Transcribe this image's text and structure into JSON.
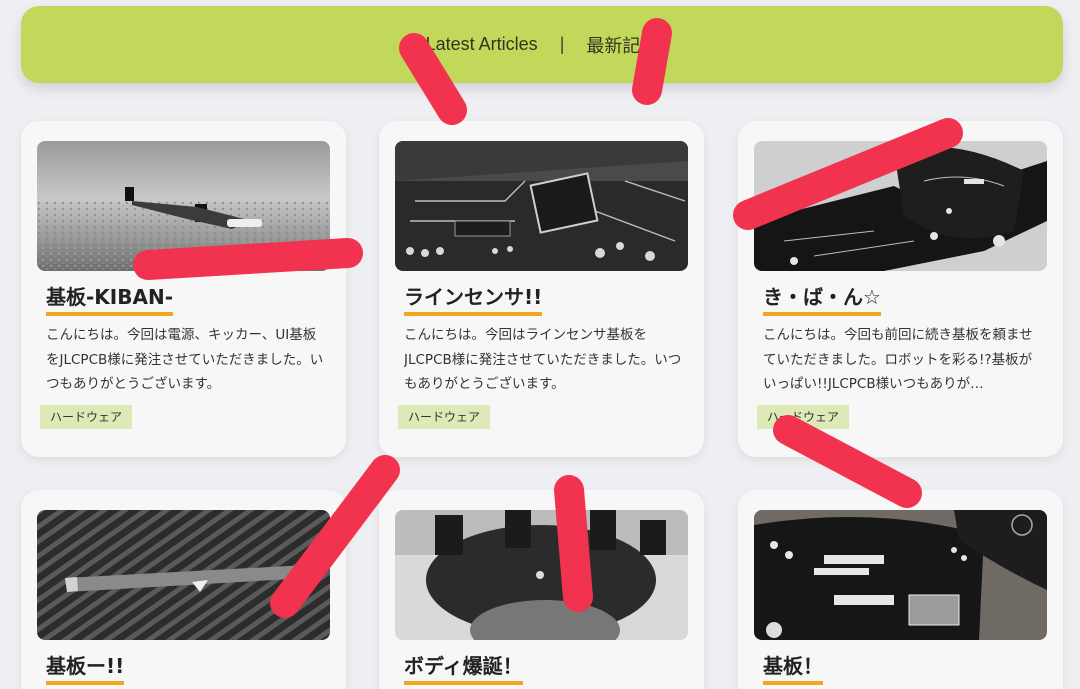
{
  "header": {
    "latest_articles": "Latest Articles",
    "separator": "|",
    "japanese_label": "最新記事"
  },
  "colors": {
    "header_bg": "#c2d85a",
    "title_underline": "#f0a61e",
    "tag_bg": "#dde9b7",
    "scribble": "#f2334f"
  },
  "cards": [
    {
      "title": "基板-KIBAN-",
      "excerpt": "こんにちは。今回は電源、キッカー、UI基板をJLCPCB様に発注させていただきました。いつもありがとうございます。",
      "tag": "ハードウェア"
    },
    {
      "title": "ラインセンサ!!",
      "excerpt": "こんにちは。今回はラインセンサ基板をJLCPCB様に発注させていただきました。いつもありがとうございます。",
      "tag": "ハードウェア"
    },
    {
      "title": "き・ば・ん☆",
      "excerpt": "こんにちは。今回も前回に続き基板を頼ませていただきました。ロボットを彩る!?基板がいっぱい!!JLCPCB様いつもありが…",
      "tag": "ハードウェア"
    },
    {
      "title": "基板ー!!"
    },
    {
      "title": "ボディ爆誕！"
    },
    {
      "title": "基板！"
    }
  ]
}
